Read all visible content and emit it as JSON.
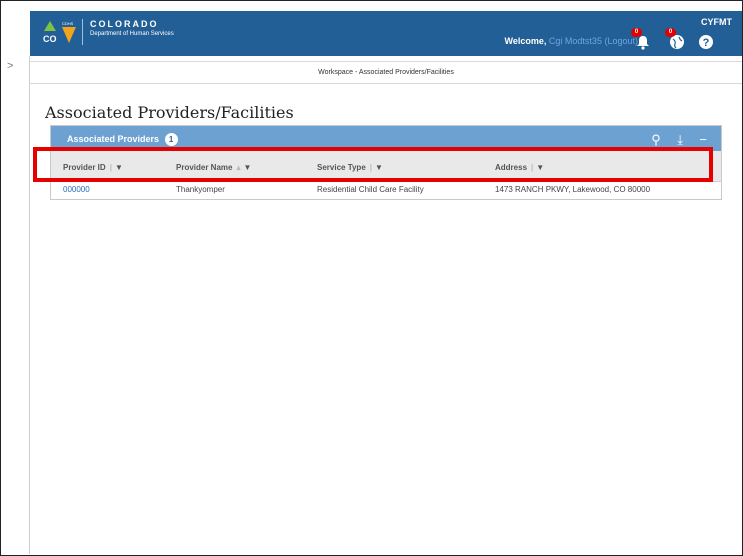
{
  "header": {
    "org_name": "COLORADO",
    "org_sub": "Department of Human Services",
    "logo_text": "CDHS",
    "logo_co": "CO",
    "welcome_prefix": "Welcome,",
    "user_name": "Cgi Modtst35",
    "logout_label": "(Logout)",
    "app_name": "CYFMT",
    "notifications_count": "0",
    "globe_count": "0",
    "help_icon": "help-icon"
  },
  "workspace": {
    "breadcrumb": "Workspace - Associated Providers/Facilities"
  },
  "page": {
    "title": "Associated Providers/Facilities"
  },
  "panel": {
    "title": "Associated Providers",
    "count": "1",
    "columns": [
      {
        "label": "Provider ID"
      },
      {
        "label": "Provider Name"
      },
      {
        "label": "Service Type"
      },
      {
        "label": "Address"
      }
    ],
    "rows": [
      {
        "provider_id": "000000",
        "provider_name": "Thankyomper",
        "service_type": "Residential Child Care Facility",
        "address": "1473 RANCH PKWY, Lakewood, CO 80000"
      }
    ]
  },
  "colors": {
    "header_bg": "#235f97",
    "panel_head_bg": "#6da1d2",
    "highlight": "#e60000",
    "badge": "#e00000"
  }
}
